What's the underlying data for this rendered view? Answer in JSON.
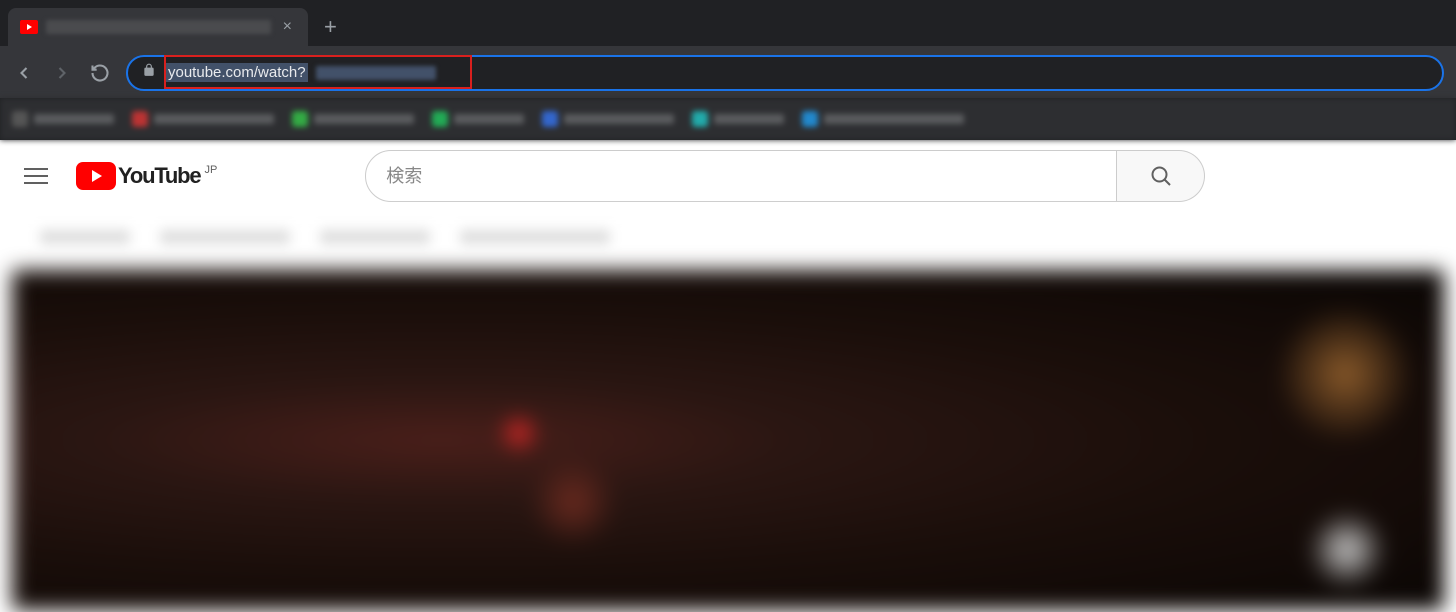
{
  "browser": {
    "tab": {
      "close": "×",
      "new_tab": "+"
    },
    "url": "youtube.com/watch?"
  },
  "youtube": {
    "logo_text": "YouTube",
    "region": "JP",
    "search": {
      "placeholder": "検索"
    }
  }
}
